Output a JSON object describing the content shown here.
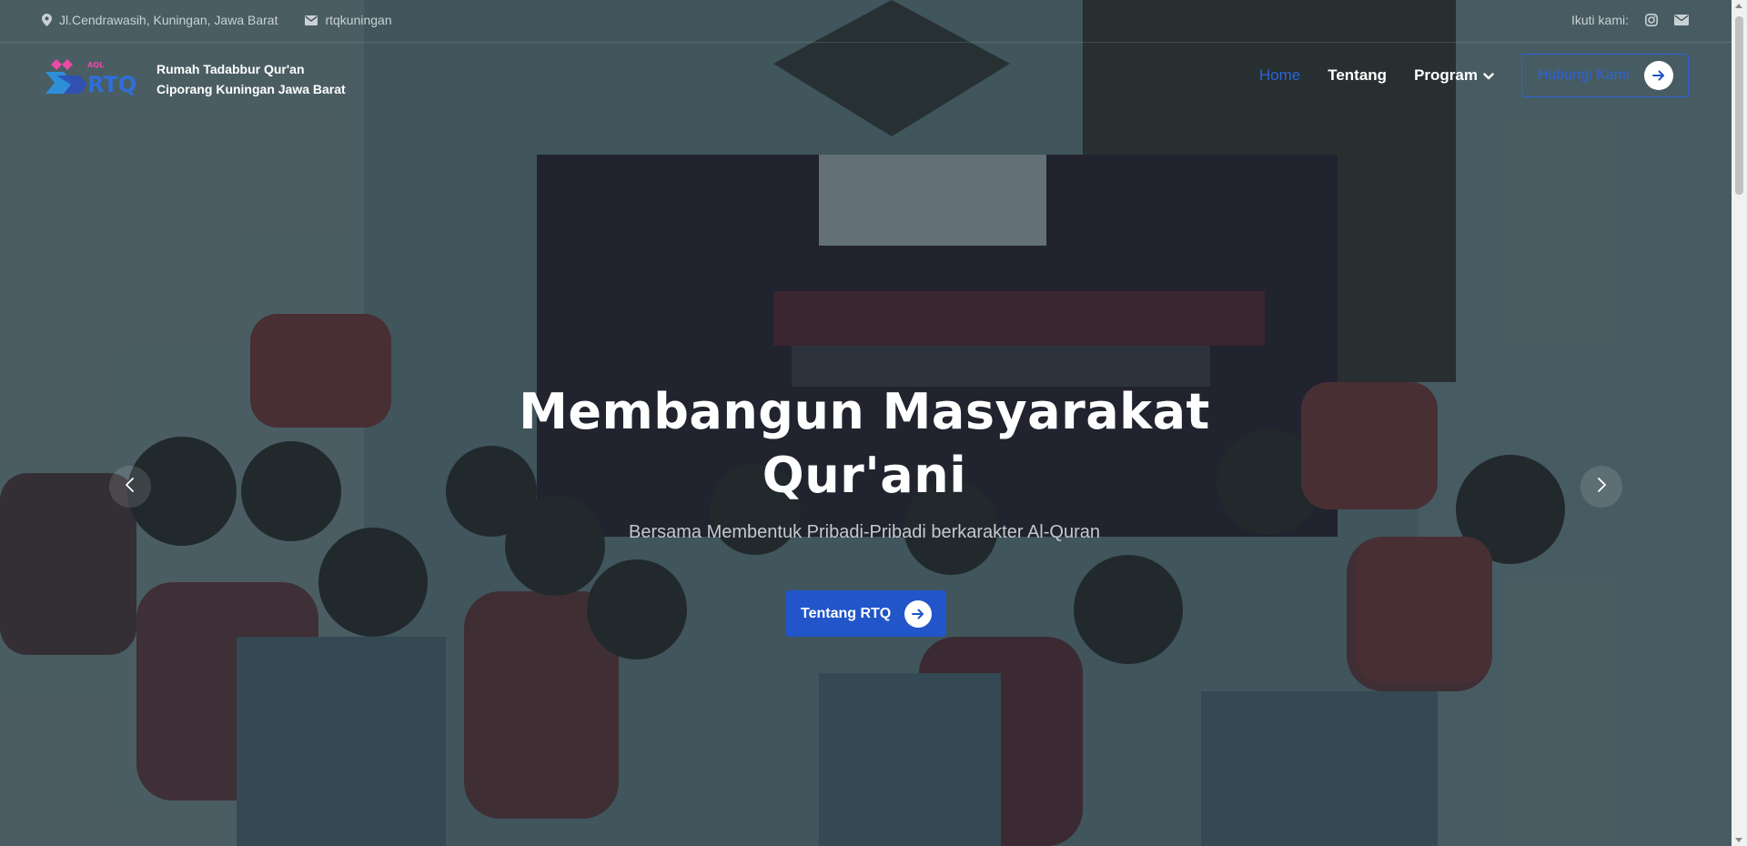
{
  "topbar": {
    "address": "Jl.Cendrawasih, Kuningan, Jawa Barat",
    "email": "rtqkuningan",
    "follow_label": "Ikuti kami:",
    "address_icon": "map-pin-icon",
    "email_icon": "envelope-icon",
    "social_icons": [
      "instagram-icon",
      "envelope-icon"
    ]
  },
  "brand": {
    "line1": "Rumah Tadabbur Qur'an",
    "line2": "Ciporang Kuningan Jawa Barat",
    "logo_text": "RTQ",
    "logo_small_text": "AQL"
  },
  "nav": {
    "items": [
      {
        "label": "Home",
        "active": true
      },
      {
        "label": "Tentang",
        "active": false
      },
      {
        "label": "Program",
        "active": false,
        "dropdown": true
      }
    ],
    "contact_label": "Hubungi Kami"
  },
  "hero": {
    "title_line1": "Membangun Masyarakat",
    "title_line2": "Qur'ani",
    "subtitle": "Bersama Membentuk Pribadi-Pribadi berkarakter Al-Quran",
    "button_label": "Tentang RTQ"
  },
  "colors": {
    "accent": "#2b63d9",
    "button_bg": "#2155c9",
    "overlay": "#122830"
  }
}
